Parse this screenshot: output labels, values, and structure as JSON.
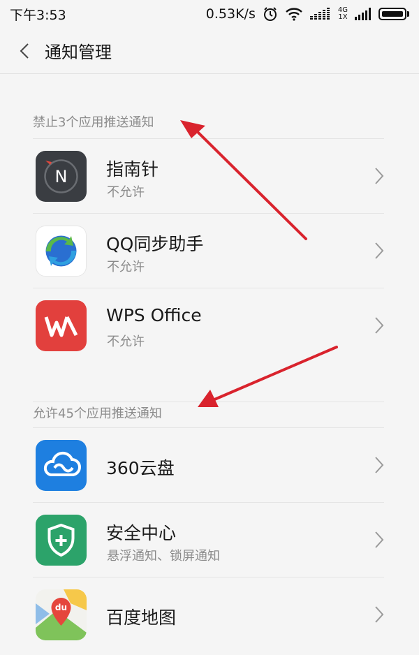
{
  "status_bar": {
    "time": "下午3:53",
    "net_speed": "0.53K/s",
    "net_badge_top": "4G",
    "net_badge_bottom": "1X"
  },
  "nav": {
    "title": "通知管理"
  },
  "sections": [
    {
      "header": "禁止3个应用推送通知",
      "apps": [
        {
          "name": "指南针",
          "status": "不允许",
          "icon": "compass-icon"
        },
        {
          "name": "QQ同步助手",
          "status": "不允许",
          "icon": "qq-sync-icon"
        },
        {
          "name": "WPS Office",
          "status": "不允许",
          "icon": "wps-icon"
        }
      ]
    },
    {
      "header": "允许45个应用推送通知",
      "apps": [
        {
          "name": "360云盘",
          "status": "",
          "icon": "cloud-icon"
        },
        {
          "name": "安全中心",
          "status": "悬浮通知、锁屏通知",
          "icon": "shield-plus-icon"
        },
        {
          "name": "百度地图",
          "status": "",
          "icon": "map-pin-icon"
        }
      ]
    }
  ],
  "colors": {
    "annotation_arrow": "#d9232d",
    "compass_bg": "#3a3d42",
    "wps_bg": "#e2403d",
    "cloud_bg": "#1e7fe0",
    "security_bg": "#2ca36a"
  }
}
